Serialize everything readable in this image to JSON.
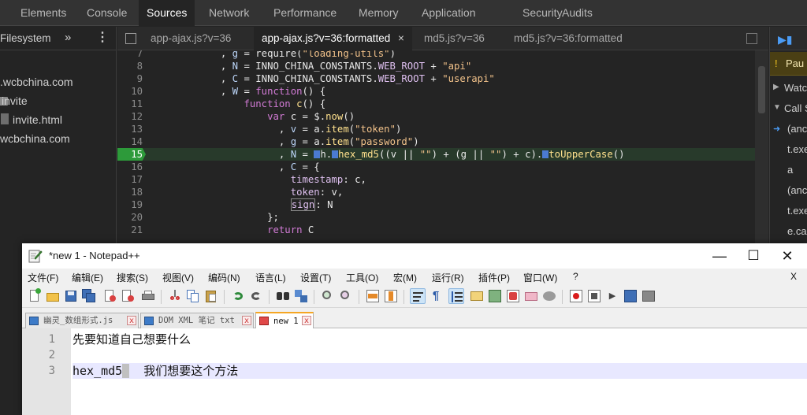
{
  "devtools": {
    "tabs": [
      "Elements",
      "Console",
      "Sources",
      "Network",
      "Performance",
      "Memory",
      "Application",
      "Security",
      "Audits"
    ],
    "active_tab": "Sources",
    "navigator": {
      "header": "Filesystem",
      "more": "»",
      "items": [
        ".wcbchina.com",
        "invite",
        "invite.html",
        "wcbchina.com"
      ]
    },
    "file_tabs": [
      "app-ajax.js?v=36",
      "app-ajax.js?v=36:formatted",
      "md5.js?v=36",
      "md5.js?v=36:formatted"
    ],
    "close_glyph": "×",
    "code_lines": [
      {
        "n": "7",
        "text": "            , g = require(\"loading-utils\")"
      },
      {
        "n": "8",
        "text": "            , N = INNO_CHINA_CONSTANTS.WEB_ROOT + \"api\""
      },
      {
        "n": "9",
        "text": "            , C = INNO_CHINA_CONSTANTS.WEB_ROOT + \"userapi\""
      },
      {
        "n": "10",
        "text": "            , W = function() {"
      },
      {
        "n": "11",
        "text": "                function c() {"
      },
      {
        "n": "12",
        "text": "                    var c = $.now()"
      },
      {
        "n": "13",
        "text": "                      , v = a.item(\"token\")"
      },
      {
        "n": "14",
        "text": "                      , g = a.item(\"password\")"
      },
      {
        "n": "15",
        "text": "                      , N = h.hex_md5((v || \"\") + (g || \"\") + c).toUpperCase()"
      },
      {
        "n": "16",
        "text": "                      , C = {"
      },
      {
        "n": "17",
        "text": "                        timestamp: c,"
      },
      {
        "n": "18",
        "text": "                        token: v,"
      },
      {
        "n": "19",
        "text": "                        sign: N"
      },
      {
        "n": "20",
        "text": "                    };"
      },
      {
        "n": "21",
        "text": "                    return C"
      }
    ],
    "breakpoint_line": "15",
    "right_panel": [
      "Pau",
      "Watc",
      "Call S",
      "(anc",
      "t.exe",
      "a",
      "(anc",
      "t.exe",
      "e.ca"
    ]
  },
  "notepad": {
    "title": "*new 1 - Notepad++",
    "window_controls": {
      "minimize": "—",
      "maximize": "☐",
      "close": "✕"
    },
    "menu": [
      "文件(F)",
      "编辑(E)",
      "搜索(S)",
      "视图(V)",
      "编码(N)",
      "语言(L)",
      "设置(T)",
      "工具(O)",
      "宏(M)",
      "运行(R)",
      "插件(P)",
      "窗口(W)",
      "?"
    ],
    "menu_close": "X",
    "tabs": [
      {
        "label": "幽灵_数组形式.js"
      },
      {
        "label": "DOM XML 笔记 txt"
      },
      {
        "label": "new 1"
      }
    ],
    "tab_close": "x",
    "lines": [
      {
        "n": "1",
        "text": "先要知道自己想要什么"
      },
      {
        "n": "2",
        "text": ""
      },
      {
        "n": "3",
        "text_before": "hex_md5",
        "selected": " ",
        "text_after": "  我们想要这个方法"
      }
    ]
  },
  "colors": {
    "breakpoint": "#2d9a3a",
    "devtools_bg": "#242424",
    "paused_banner": "#4a3f14",
    "active_tab_indicator": "#f5a623"
  }
}
